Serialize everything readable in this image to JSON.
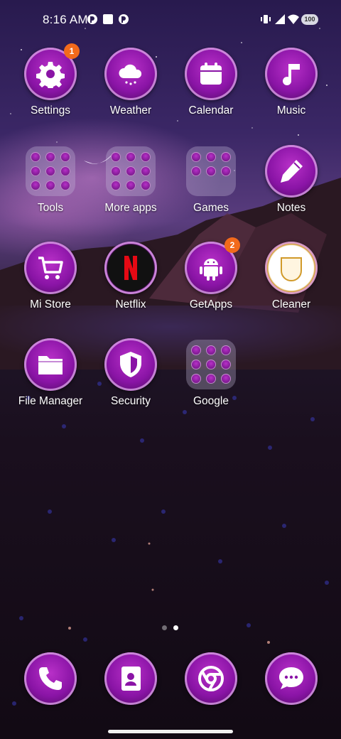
{
  "status_bar": {
    "time": "8:16 AM",
    "battery": "100",
    "icons": [
      "notification-app-icon",
      "square-notification-icon",
      "notification-app-icon",
      "vibrate-icon",
      "signal-icon",
      "wifi-icon",
      "battery-icon"
    ]
  },
  "apps": [
    {
      "label": "Settings",
      "icon": "gear-icon",
      "badge": "1"
    },
    {
      "label": "Weather",
      "icon": "cloud-rain-icon"
    },
    {
      "label": "Calendar",
      "icon": "calendar-icon"
    },
    {
      "label": "Music",
      "icon": "music-note-icon"
    },
    {
      "label": "Tools",
      "icon": "folder-icon"
    },
    {
      "label": "More apps",
      "icon": "folder-icon"
    },
    {
      "label": "Games",
      "icon": "folder-icon"
    },
    {
      "label": "Notes",
      "icon": "pencil-icon"
    },
    {
      "label": "Mi Store",
      "icon": "cart-icon"
    },
    {
      "label": "Netflix",
      "icon": "netflix-icon"
    },
    {
      "label": "GetApps",
      "icon": "android-icon",
      "badge": "2"
    },
    {
      "label": "Cleaner",
      "icon": "cleaner-icon"
    },
    {
      "label": "File Manager",
      "icon": "folder-file-icon"
    },
    {
      "label": "Security",
      "icon": "shield-icon"
    },
    {
      "label": "Google",
      "icon": "folder-icon"
    }
  ],
  "dock": [
    {
      "icon": "phone-icon"
    },
    {
      "icon": "contacts-icon"
    },
    {
      "icon": "chrome-icon"
    },
    {
      "icon": "messages-icon"
    }
  ],
  "page_indicator": {
    "pages": 2,
    "active": 2
  },
  "colors": {
    "icon_fill": "#8a14a6",
    "badge": "#f26a1b",
    "accent_glow": "#b830c8"
  }
}
